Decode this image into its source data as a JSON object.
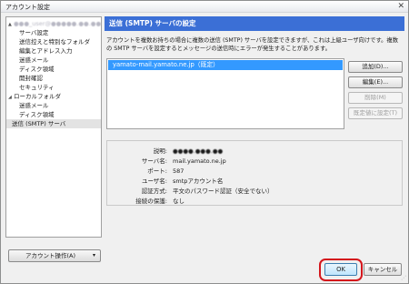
{
  "window": {
    "title": "アカウント設定",
    "close_glyph": "✕"
  },
  "tree": {
    "items": [
      {
        "twisty": "▲",
        "label": "●●●_user@●●●●●.●●.●●",
        "blurred": true
      },
      {
        "label": "サーバ設定"
      },
      {
        "label": "送信控えと特別なフォルダ"
      },
      {
        "label": "編集とアドレス入力"
      },
      {
        "label": "迷惑メール"
      },
      {
        "label": "ディスク領域"
      },
      {
        "label": "開封確認"
      },
      {
        "label": "セキュリティ"
      },
      {
        "twisty": "◢",
        "label": "ローカルフォルダ"
      },
      {
        "label": "迷惑メール"
      },
      {
        "label": "ディスク領域"
      },
      {
        "label": "送信 (SMTP) サーバ",
        "selected": true
      }
    ]
  },
  "account_actions": {
    "label": "アカウント操作(A)",
    "caret": "▾"
  },
  "smtp": {
    "header": "送信 (SMTP) サーバの設定",
    "description": "アカウントを複数お持ちの場合に複数の送信 (SMTP) サーバを設定できますが、これは上級ユーザ向けです。複数の SMTP サーバを設定するとメッセージの送信時にエラーが発生することがあります。",
    "servers": [
      "yamato-mail.yamato.ne.jp（既定）"
    ],
    "buttons": {
      "add": "追加(D)...",
      "edit": "編集(E)...",
      "delete": "削除(M)",
      "set_default": "既定値に設定(T)"
    },
    "details": {
      "description_label": "説明:",
      "description_value": "●●●●.●●●.●●",
      "server_label": "サーバ名:",
      "server_value": "mail.yamato.ne.jp",
      "port_label": "ポート:",
      "port_value": "587",
      "user_label": "ユーザ名:",
      "user_value": "smtpアカウント名",
      "auth_label": "認証方式:",
      "auth_value": "平文のパスワード認証（安全でない）",
      "security_label": "接続の保護:",
      "security_value": "なし"
    }
  },
  "footer": {
    "ok": "OK",
    "cancel": "キャンセル",
    "highlight_color": "#d4161c"
  },
  "colors": {
    "header_bg": "#3b6fd6",
    "selection_bg": "#3399ff"
  }
}
